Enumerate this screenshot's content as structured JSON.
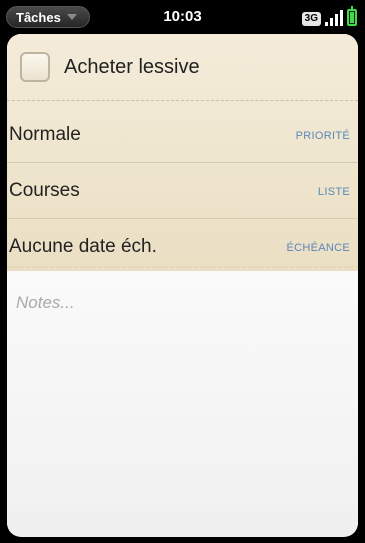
{
  "status_bar": {
    "app_name": "Tâches",
    "time": "10:03",
    "network": "3G"
  },
  "task": {
    "title": "Acheter lessive",
    "checked": false
  },
  "fields": [
    {
      "value": "Normale",
      "label": "PRIORITÉ"
    },
    {
      "value": "Courses",
      "label": "LISTE"
    },
    {
      "value": "Aucune date éch.",
      "label": "ÉCHÉANCE"
    }
  ],
  "notes": {
    "placeholder": "Notes..."
  },
  "colors": {
    "accent_label": "#5c86b8",
    "battery": "#3fdc4a",
    "paper": "#efe6cf"
  }
}
